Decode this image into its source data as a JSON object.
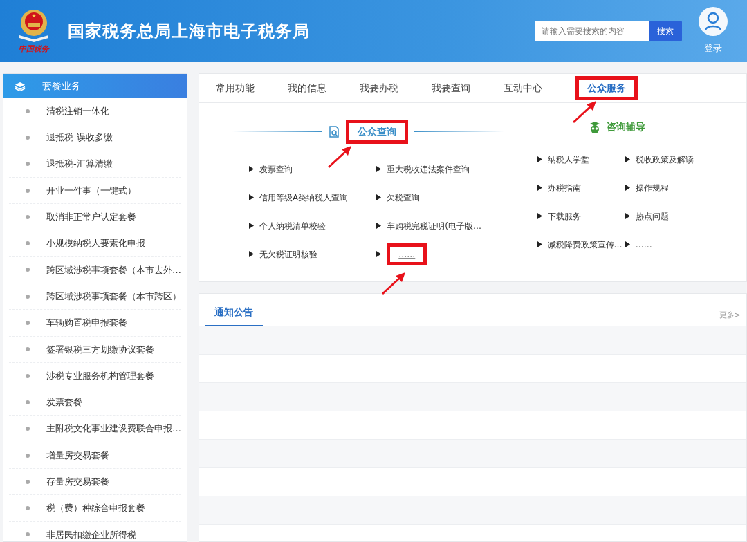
{
  "header": {
    "logo_caption": "中国税务",
    "title": "国家税务总局上海市电子税务局",
    "search": {
      "placeholder": "请输入需要搜索的内容",
      "button": "搜索"
    },
    "login": "登录"
  },
  "sidebar": {
    "title": "套餐业务",
    "items": [
      {
        "label": "清税注销一体化"
      },
      {
        "label": "退抵税-误收多缴"
      },
      {
        "label": "退抵税-汇算清缴"
      },
      {
        "label": "开业一件事（一键式）"
      },
      {
        "label": "取消非正常户认定套餐"
      },
      {
        "label": "小规模纳税人要素化申报"
      },
      {
        "label": "跨区域涉税事项套餐（本市去外…"
      },
      {
        "label": "跨区域涉税事项套餐（本市跨区）"
      },
      {
        "label": "车辆购置税申报套餐"
      },
      {
        "label": "签署银税三方划缴协议套餐"
      },
      {
        "label": "涉税专业服务机构管理套餐"
      },
      {
        "label": "发票套餐"
      },
      {
        "label": "主附税文化事业建设费联合申报…"
      },
      {
        "label": "增量房交易套餐"
      },
      {
        "label": "存量房交易套餐"
      },
      {
        "label": "税（费）种综合申报套餐"
      },
      {
        "label": "非居民扣缴企业所得税"
      }
    ]
  },
  "tabs": [
    {
      "label": "常用功能",
      "selected": false,
      "highlighted": false
    },
    {
      "label": "我的信息",
      "selected": false,
      "highlighted": false
    },
    {
      "label": "我要办税",
      "selected": false,
      "highlighted": false
    },
    {
      "label": "我要查询",
      "selected": false,
      "highlighted": false
    },
    {
      "label": "互动中心",
      "selected": false,
      "highlighted": false
    },
    {
      "label": "公众服务",
      "selected": true,
      "highlighted": true
    }
  ],
  "sections": [
    {
      "kind": "query",
      "title": "公众查询",
      "highlighted": true,
      "links": [
        {
          "label": "发票查询",
          "highlighted": false
        },
        {
          "label": "重大税收违法案件查询",
          "highlighted": false
        },
        {
          "label": "信用等级A类纳税人查询",
          "highlighted": false
        },
        {
          "label": "欠税查询",
          "highlighted": false
        },
        {
          "label": "个人纳税清单校验",
          "highlighted": false
        },
        {
          "label": "车购税完税证明(电子版…",
          "highlighted": false
        },
        {
          "label": "无欠税证明核验",
          "highlighted": false
        },
        {
          "label": "……",
          "highlighted": true
        }
      ]
    },
    {
      "kind": "consult",
      "title": "咨询辅导",
      "highlighted": false,
      "links": [
        {
          "label": "纳税人学堂",
          "highlighted": false
        },
        {
          "label": "税收政策及解读",
          "highlighted": false
        },
        {
          "label": "办税指南",
          "highlighted": false
        },
        {
          "label": "操作规程",
          "highlighted": false
        },
        {
          "label": "下载服务",
          "highlighted": false
        },
        {
          "label": "热点问题",
          "highlighted": false
        },
        {
          "label": "减税降费政策宣传…",
          "highlighted": false
        },
        {
          "label": "……",
          "highlighted": false
        }
      ]
    }
  ],
  "notices": {
    "tab": "通知公告",
    "more": "更多>"
  }
}
